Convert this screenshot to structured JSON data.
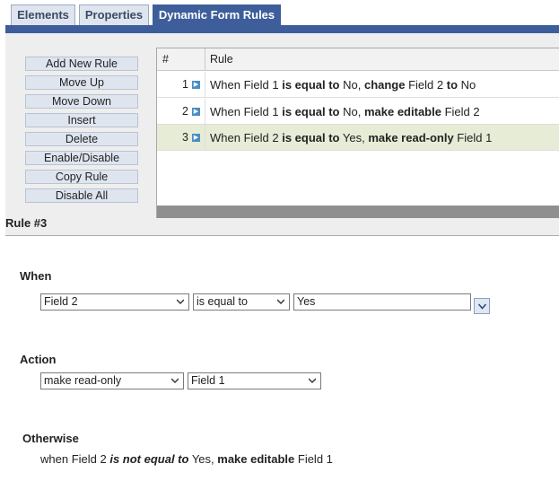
{
  "tabs": [
    {
      "label": "Elements",
      "active": false
    },
    {
      "label": "Properties",
      "active": false
    },
    {
      "label": "Dynamic Form Rules",
      "active": true
    }
  ],
  "buttons": [
    "Add New Rule",
    "Move Up",
    "Move Down",
    "Insert",
    "Delete",
    "Enable/Disable",
    "Copy Rule",
    "Disable All"
  ],
  "grid": {
    "columns": [
      "#",
      "Rule"
    ],
    "rows": [
      {
        "num": "1",
        "parts": [
          {
            "t": "When Field 1 ",
            "b": false
          },
          {
            "t": "is equal to",
            "b": true
          },
          {
            "t": " No, ",
            "b": false
          },
          {
            "t": "change",
            "b": true
          },
          {
            "t": " Field 2 ",
            "b": false
          },
          {
            "t": "to",
            "b": true
          },
          {
            "t": " No",
            "b": false
          }
        ]
      },
      {
        "num": "2",
        "parts": [
          {
            "t": "When Field 1 ",
            "b": false
          },
          {
            "t": "is equal to",
            "b": true
          },
          {
            "t": " No, ",
            "b": false
          },
          {
            "t": "make editable",
            "b": true
          },
          {
            "t": " Field 2",
            "b": false
          }
        ]
      },
      {
        "num": "3",
        "selected": true,
        "parts": [
          {
            "t": "When Field 2 ",
            "b": false
          },
          {
            "t": "is equal to",
            "b": true
          },
          {
            "t": " Yes, ",
            "b": false
          },
          {
            "t": "make read-only",
            "b": true
          },
          {
            "t": " Field 1",
            "b": false
          }
        ]
      }
    ]
  },
  "rule_label": "Rule #3",
  "when": {
    "title": "When",
    "field": "Field 2",
    "operator": "is equal to",
    "value": "Yes"
  },
  "action": {
    "title": "Action",
    "action": "make read-only",
    "target": "Field 1"
  },
  "otherwise": {
    "title": "Otherwise",
    "prefix": "when Field 2 ",
    "operator": "is not equal to",
    "value_text": " Yes, ",
    "action": "make editable",
    "target": " Field 1"
  },
  "colors": {
    "tab_active": "#3d5e9a",
    "selected_row": "#e6ecd6",
    "button_bg": "#dfe5ef"
  }
}
